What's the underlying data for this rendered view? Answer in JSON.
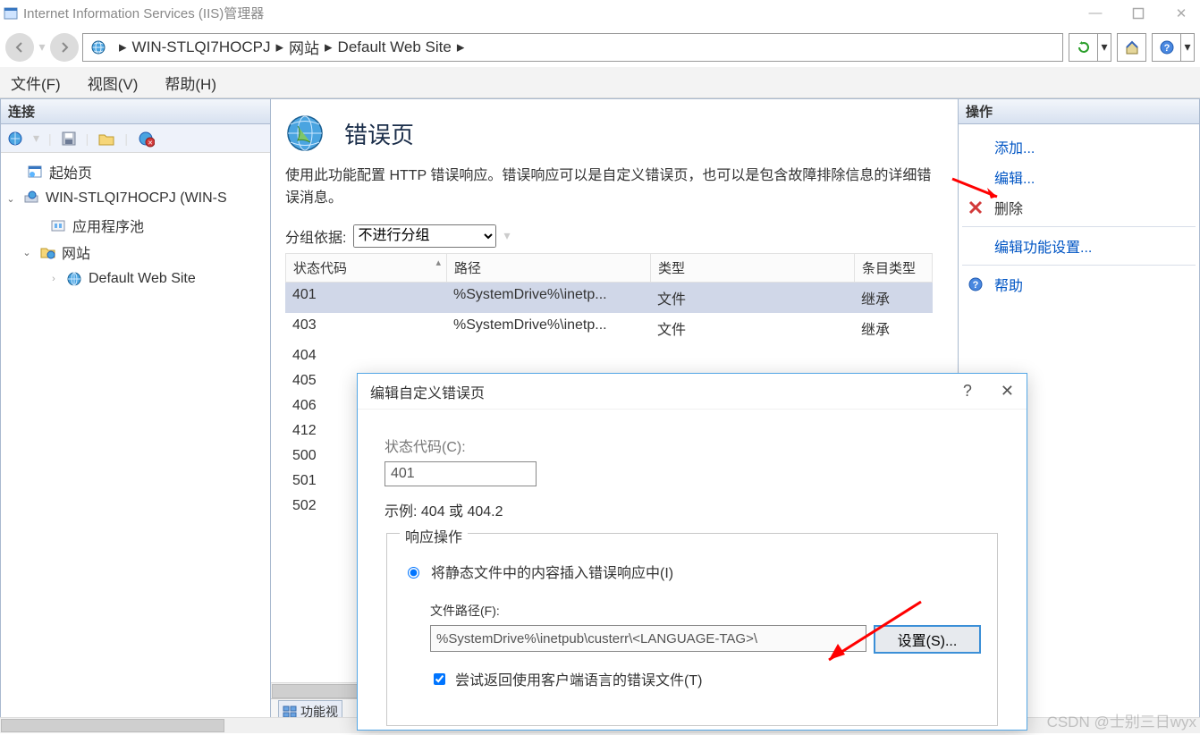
{
  "window": {
    "title": "Internet Information Services (IIS)管理器",
    "min_tooltip": "Minimize",
    "max_tooltip": "Maximize",
    "close_tooltip": "Close"
  },
  "breadcrumb": {
    "items": [
      "WIN-STLQI7HOCPJ",
      "网站",
      "Default Web Site"
    ]
  },
  "menu": {
    "file": "文件(F)",
    "view": "视图(V)",
    "help": "帮助(H)"
  },
  "left": {
    "header": "连接",
    "tree": {
      "start": "起始页",
      "server": "WIN-STLQI7HOCPJ (WIN-S",
      "apppools": "应用程序池",
      "sites": "网站",
      "defaultsite": "Default Web Site"
    }
  },
  "center": {
    "title": "错误页",
    "desc": "使用此功能配置 HTTP 错误响应。错误响应可以是自定义错误页，也可以是包含故障排除信息的详细错误消息。",
    "grouping_label": "分组依据:",
    "grouping_value": "不进行分组",
    "headers": {
      "status": "状态代码",
      "path": "路径",
      "type": "类型",
      "entry": "条目类型"
    },
    "rows": [
      {
        "status": "401",
        "path": "%SystemDrive%\\inetp...",
        "type": "文件",
        "entry": "继承"
      },
      {
        "status": "403",
        "path": "%SystemDrive%\\inetp...",
        "type": "文件",
        "entry": "继承"
      },
      {
        "status": "404"
      },
      {
        "status": "405"
      },
      {
        "status": "406"
      },
      {
        "status": "412"
      },
      {
        "status": "500"
      },
      {
        "status": "501"
      },
      {
        "status": "502"
      }
    ],
    "statusbar_view": "功能视"
  },
  "right": {
    "header": "操作",
    "add": "添加...",
    "edit": "编辑...",
    "delete": "删除",
    "featuresettings": "编辑功能设置...",
    "help": "帮助"
  },
  "dialog": {
    "title": "编辑自定义错误页",
    "status_label": "状态代码(C):",
    "status_value": "401",
    "example": "示例: 404 或 404.2",
    "response_legend": "响应操作",
    "radio_static": "将静态文件中的内容插入错误响应中(I)",
    "filepath_label": "文件路径(F):",
    "filepath_value": "%SystemDrive%\\inetpub\\custerr\\<LANGUAGE-TAG>\\",
    "settings_btn": "设置(S)...",
    "checkbox_label": "尝试返回使用客户端语言的错误文件(T)"
  },
  "watermark": "CSDN @士别三日wyx"
}
